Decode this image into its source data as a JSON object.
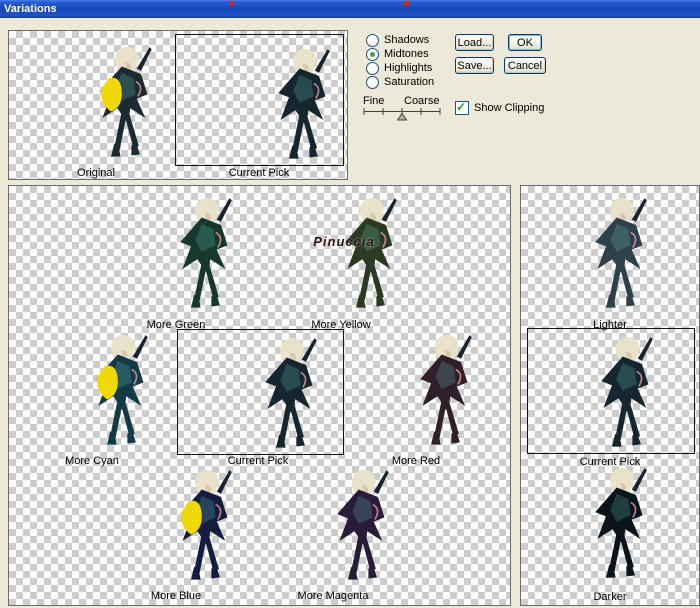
{
  "window": {
    "title": "Variations"
  },
  "palette": {
    "hair": "#e8e2c9",
    "clip_color": "#f0d806",
    "titlebar_red_mark": "#cf2b1d"
  },
  "controls": {
    "radio_options": [
      {
        "label": "Shadows",
        "selected": 0
      },
      {
        "label": "Midtones",
        "selected": 1
      },
      {
        "label": "Highlights",
        "selected": 0
      },
      {
        "label": "Saturation",
        "selected": 0
      }
    ],
    "buttons": {
      "load": "Load...",
      "save": "Save...",
      "ok": "OK",
      "cancel": "Cancel"
    },
    "slider": {
      "left": "Fine",
      "right": "Coarse"
    },
    "show_clipping": {
      "label": "Show Clipping",
      "checked": 1
    }
  },
  "top_panel": {
    "tiles": [
      {
        "label": "Original",
        "tint": "#1c2b31",
        "clip": 1
      },
      {
        "label": "Current Pick",
        "tint": "#15262e",
        "clip": 0
      }
    ]
  },
  "main_panel": {
    "tiles": [
      {
        "label": "More Green",
        "tint": "#17392d",
        "clip": 0
      },
      {
        "label": "More Yellow",
        "tint": "#2c3a24",
        "clip": 0,
        "watermark": "Pinuccia"
      },
      {
        "label": "More Cyan",
        "tint": "#133a46",
        "clip": 1
      },
      {
        "label": "Current Pick",
        "tint": "#15262e",
        "clip": 0
      },
      {
        "label": "More Red",
        "tint": "#2f1f2a",
        "clip": 0
      },
      {
        "label": "More Blue",
        "tint": "#141d3f",
        "clip": 1
      },
      {
        "label": "More Magenta",
        "tint": "#281c39",
        "clip": 0
      }
    ]
  },
  "right_panel": {
    "tiles": [
      {
        "label": "Lighter",
        "tint": "#2e404a",
        "clip": 0
      },
      {
        "label": "Current Pick",
        "tint": "#15262e",
        "clip": 0
      },
      {
        "label": "Darker",
        "tint": "#0a141a",
        "clip": 0
      }
    ]
  }
}
